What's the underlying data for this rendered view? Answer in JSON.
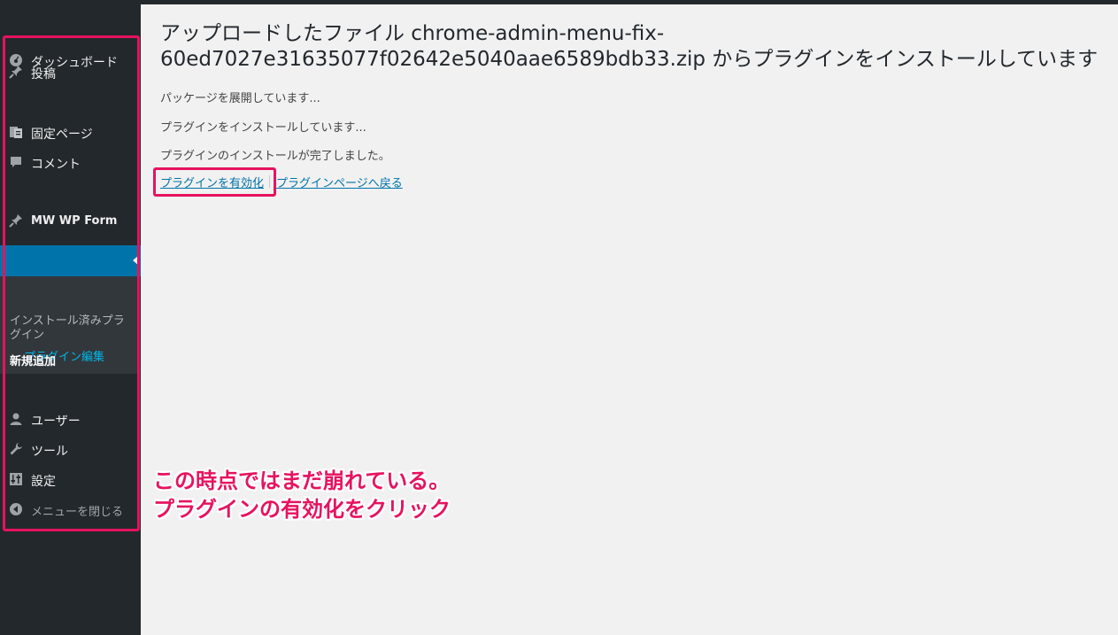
{
  "sidebar": {
    "dashboard": "ダッシュボード",
    "posts": "投稿",
    "pages_overlap": "固定ペ",
    "pages_overlap2": "ージ",
    "comments": "コメント",
    "mwwpform": "MW WP Form",
    "submenu_installed": "インストール済みプラグイン",
    "submenu_editor": "プラグイン編集",
    "submenu_add": "新規追加",
    "users": "ユーザー",
    "tools": "ツール",
    "settings": "設定",
    "collapse": "メニューを閉じる"
  },
  "main": {
    "title_line1": "アップロードしたファイル chrome-admin-menu-fix-",
    "title_line2": "60ed7027e31635077f02642e5040aae6589bdb33.zip からプラグインをインストールしています",
    "msg1": "パッケージを展開しています...",
    "msg2": "プラグインをインストールしています...",
    "msg3": "プラグインのインストールが完了しました。",
    "activate_link": "プラグインを有効化",
    "back_link": "プラグインページへ戻る"
  },
  "annotation": {
    "line1": "この時点ではまだ崩れている。",
    "line2": "プラグインの有効化をクリック"
  },
  "colors": {
    "sidebar_bg": "#23282d",
    "active": "#0073aa",
    "highlight": "#e6135f",
    "content_bg": "#f1f1f1"
  }
}
